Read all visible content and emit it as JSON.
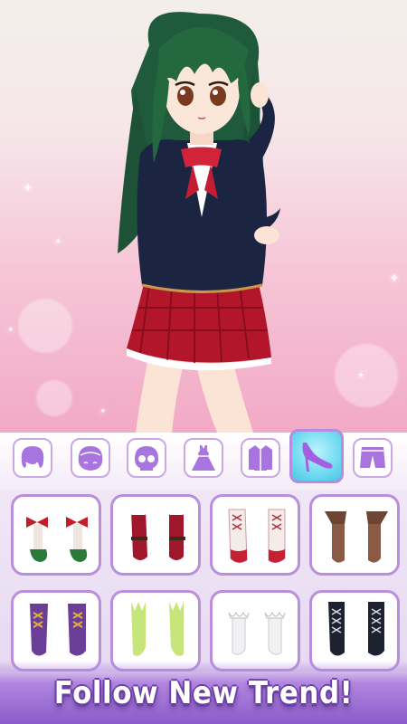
{
  "banner": {
    "text": "Follow New Trend!"
  },
  "categories": [
    {
      "name": "hair-front",
      "icon": "hair-icon"
    },
    {
      "name": "hair-back",
      "icon": "face-icon"
    },
    {
      "name": "face",
      "icon": "skull-face-icon"
    },
    {
      "name": "dress",
      "icon": "dress-icon"
    },
    {
      "name": "jacket",
      "icon": "jacket-icon"
    },
    {
      "name": "shoes",
      "icon": "high-heel-icon",
      "selected": true
    },
    {
      "name": "bottoms",
      "icon": "shorts-icon"
    }
  ],
  "items": [
    {
      "icon": "bow-shoes-icon"
    },
    {
      "icon": "red-boots-icon"
    },
    {
      "icon": "lace-up-boots-icon"
    },
    {
      "icon": "brown-boots-icon"
    },
    {
      "icon": "purple-boots-icon"
    },
    {
      "icon": "green-socks-icon"
    },
    {
      "icon": "white-ruffle-socks-icon"
    },
    {
      "icon": "black-boots-icon"
    }
  ],
  "colors": {
    "accent": "#b98fdc",
    "selected_tab": "#67d6ee",
    "banner": "#8a5cc9"
  }
}
